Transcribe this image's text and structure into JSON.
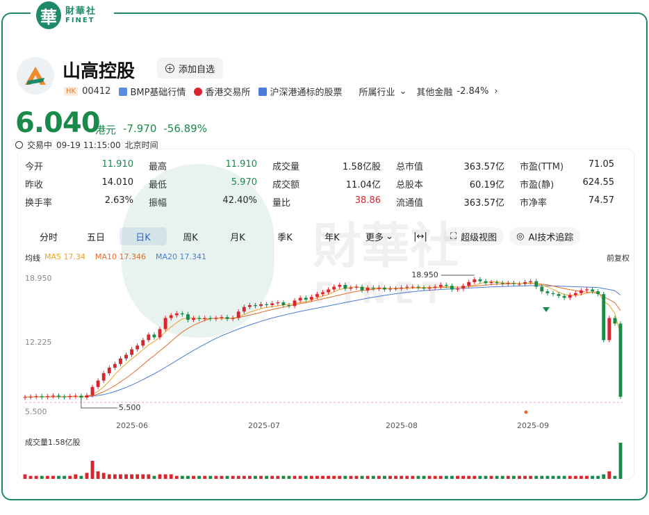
{
  "brand": {
    "mark": "華",
    "name_cn": "財華社",
    "name_en": "FINET"
  },
  "stock": {
    "name": "山高控股",
    "market_tag": "HK",
    "code": "00412",
    "watch_label": "添加自选",
    "links": [
      "BMP基础行情",
      "香港交易所",
      "沪深港通标的股票"
    ],
    "industry_label": "所属行业",
    "industry_name": "其他金融",
    "industry_change": "-2.84%"
  },
  "quote": {
    "price": "6.040",
    "currency": "港元",
    "change": "-7.970",
    "change_pct": "-56.89%",
    "status": "交易中",
    "time": "09-19 11:15:00",
    "tz": "北京时间"
  },
  "stats": [
    [
      {
        "label": "今开",
        "value": "11.910",
        "color": "#1a8a4a"
      },
      {
        "label": "最高",
        "value": "11.910",
        "color": "#1a8a4a"
      },
      {
        "label": "成交量",
        "value": "1.58亿股",
        "color": "#222"
      },
      {
        "label": "总市值",
        "value": "363.57亿",
        "color": "#222"
      },
      {
        "label": "市盈(TTM)",
        "value": "71.05",
        "color": "#222"
      }
    ],
    [
      {
        "label": "昨收",
        "value": "14.010",
        "color": "#222"
      },
      {
        "label": "最低",
        "value": "5.970",
        "color": "#1a8a4a"
      },
      {
        "label": "成交额",
        "value": "11.04亿",
        "color": "#222"
      },
      {
        "label": "总股本",
        "value": "60.19亿",
        "color": "#222"
      },
      {
        "label": "市盈(静)",
        "value": "624.55",
        "color": "#222"
      }
    ],
    [
      {
        "label": "换手率",
        "value": "2.63%",
        "color": "#222"
      },
      {
        "label": "振幅",
        "value": "42.40%",
        "color": "#222"
      },
      {
        "label": "量比",
        "value": "38.86",
        "color": "#d9262e"
      },
      {
        "label": "流通值",
        "value": "363.57亿",
        "color": "#222"
      },
      {
        "label": "市净率",
        "value": "74.57",
        "color": "#222"
      }
    ]
  ],
  "tabs": [
    "分时",
    "五日",
    "日K",
    "周K",
    "月K",
    "季K",
    "年K",
    "更多"
  ],
  "tools": {
    "fullscreen": "超级视图",
    "ai": "AI技术追踪"
  },
  "ma": {
    "label": "均线",
    "ma5": "MA5 17.34",
    "ma10": "MA10 17.346",
    "ma20": "MA20 17.341",
    "adjust": "前复权"
  },
  "colors": {
    "up": "#d9262e",
    "down": "#1a8a4a",
    "ma5": "#f0a020",
    "ma10": "#e86b2a",
    "ma20": "#4a7bd8",
    "accent": "#1f8a6a"
  },
  "chart_data": {
    "type": "candlestick",
    "y_ticks": [
      "18.950",
      "12.225",
      "5.500"
    ],
    "ylim": [
      5.5,
      18.95
    ],
    "x_ticks": [
      "2025-06",
      "2025-07",
      "2025-08",
      "2025-09"
    ],
    "max_label": "18.950",
    "min_label": "5.500",
    "volume_label": "成交量1.58亿股",
    "close": [
      6.0,
      6.05,
      6.1,
      6.0,
      6.1,
      6.15,
      6.05,
      6.0,
      6.1,
      6.15,
      5.95,
      6.2,
      7.1,
      7.8,
      8.6,
      9.2,
      9.6,
      10.2,
      10.6,
      11.2,
      11.6,
      12.2,
      12.8,
      12.5,
      13.4,
      14.6,
      14.9,
      15.1,
      15.0,
      14.4,
      14.6,
      14.5,
      14.6,
      14.5,
      14.6,
      14.7,
      14.5,
      14.6,
      15.3,
      15.8,
      16.0,
      15.9,
      16.1,
      16.0,
      16.2,
      16.3,
      16.0,
      15.9,
      16.5,
      16.8,
      16.6,
      16.9,
      17.2,
      17.4,
      17.7,
      18.0,
      18.2,
      17.8,
      17.9,
      18.0,
      17.6,
      17.9,
      17.8,
      17.9,
      17.7,
      17.8,
      17.8,
      17.9,
      18.0,
      18.0,
      17.9,
      17.8,
      17.9,
      18.0,
      18.2,
      18.1,
      17.7,
      17.8,
      18.1,
      18.5,
      18.8,
      18.6,
      18.4,
      18.5,
      18.4,
      18.3,
      18.4,
      18.3,
      18.3,
      18.5,
      18.6,
      18.0,
      17.5,
      17.3,
      17.2,
      17.0,
      16.8,
      17.1,
      17.3,
      17.6,
      17.7,
      17.5,
      17.2,
      12.2,
      14.6,
      14.0,
      6.04
    ],
    "ma5": [
      6.0,
      6.03,
      6.05,
      6.04,
      6.05,
      6.08,
      6.08,
      6.07,
      6.08,
      6.09,
      6.05,
      6.09,
      6.3,
      6.64,
      7.12,
      7.74,
      8.46,
      9.08,
      9.64,
      10.16,
      10.64,
      11.16,
      11.68,
      12.06,
      12.5,
      13.1,
      13.64,
      14.1,
      14.5,
      14.6,
      14.6,
      14.52,
      14.52,
      14.52,
      14.56,
      14.58,
      14.58,
      14.58,
      14.74,
      14.98,
      15.24,
      15.42,
      15.62,
      15.76,
      15.84,
      15.92,
      16.02,
      16.08,
      16.18,
      16.3,
      16.36,
      16.54,
      16.8,
      16.98,
      17.16,
      17.44,
      17.7,
      17.82,
      17.92,
      17.98,
      17.9,
      17.84,
      17.84,
      17.84,
      17.78,
      17.82,
      17.8,
      17.82,
      17.84,
      17.88,
      17.92,
      17.92,
      17.92,
      17.92,
      17.96,
      18.0,
      17.98,
      17.96,
      17.98,
      18.04,
      18.18,
      18.36,
      18.48,
      18.56,
      18.54,
      18.44,
      18.4,
      18.38,
      18.34,
      18.36,
      18.42,
      18.34,
      18.18,
      17.98,
      17.72,
      17.4,
      17.16,
      17.08,
      17.08,
      17.16,
      17.3,
      17.44,
      17.46,
      16.44,
      15.98,
      15.1,
      12.8
    ],
    "ma10": [
      6.0,
      6.02,
      6.03,
      6.03,
      6.04,
      6.05,
      6.05,
      6.05,
      6.06,
      6.07,
      6.06,
      6.08,
      6.16,
      6.34,
      6.58,
      6.9,
      7.26,
      7.66,
      8.08,
      8.52,
      9.0,
      9.52,
      10.06,
      10.52,
      11.02,
      11.52,
      12.04,
      12.58,
      13.08,
      13.48,
      13.82,
      14.08,
      14.34,
      14.52,
      14.58,
      14.6,
      14.56,
      14.56,
      14.66,
      14.78,
      14.92,
      15.06,
      15.22,
      15.38,
      15.52,
      15.66,
      15.78,
      15.9,
      16.04,
      16.16,
      16.26,
      16.4,
      16.54,
      16.68,
      16.82,
      16.96,
      17.1,
      17.24,
      17.38,
      17.5,
      17.6,
      17.66,
      17.72,
      17.78,
      17.8,
      17.82,
      17.83,
      17.84,
      17.85,
      17.86,
      17.87,
      17.88,
      17.89,
      17.9,
      17.92,
      17.94,
      17.95,
      17.96,
      17.98,
      18.02,
      18.06,
      18.12,
      18.18,
      18.24,
      18.28,
      18.3,
      18.32,
      18.34,
      18.35,
      18.36,
      18.37,
      18.34,
      18.28,
      18.2,
      18.08,
      17.94,
      17.8,
      17.68,
      17.58,
      17.5,
      17.42,
      17.36,
      17.3,
      16.92,
      16.6,
      16.26,
      15.4
    ],
    "ma20": [
      6.0,
      6.01,
      6.02,
      6.02,
      6.03,
      6.03,
      6.04,
      6.04,
      6.05,
      6.05,
      6.05,
      6.06,
      6.1,
      6.18,
      6.28,
      6.42,
      6.6,
      6.82,
      7.06,
      7.32,
      7.6,
      7.9,
      8.22,
      8.54,
      8.88,
      9.24,
      9.6,
      9.98,
      10.36,
      10.72,
      11.08,
      11.42,
      11.76,
      12.08,
      12.38,
      12.66,
      12.92,
      13.16,
      13.4,
      13.62,
      13.84,
      14.04,
      14.24,
      14.42,
      14.6,
      14.76,
      14.9,
      15.04,
      15.18,
      15.32,
      15.44,
      15.56,
      15.68,
      15.8,
      15.92,
      16.04,
      16.16,
      16.28,
      16.4,
      16.52,
      16.64,
      16.76,
      16.86,
      16.96,
      17.06,
      17.16,
      17.24,
      17.32,
      17.4,
      17.46,
      17.52,
      17.58,
      17.62,
      17.66,
      17.7,
      17.74,
      17.77,
      17.8,
      17.83,
      17.86,
      17.89,
      17.92,
      17.95,
      17.98,
      18.0,
      18.02,
      18.04,
      18.06,
      18.08,
      18.1,
      18.12,
      18.12,
      18.11,
      18.1,
      18.08,
      18.06,
      18.04,
      18.02,
      18.0,
      17.98,
      17.96,
      17.94,
      17.92,
      17.8,
      17.7,
      17.56,
      17.1
    ],
    "volume": [
      0.03,
      0.02,
      0.02,
      0.02,
      0.02,
      0.02,
      0.02,
      0.02,
      0.02,
      0.03,
      0.02,
      0.04,
      0.12,
      0.05,
      0.04,
      0.03,
      0.03,
      0.03,
      0.03,
      0.03,
      0.03,
      0.03,
      0.03,
      0.02,
      0.03,
      0.03,
      0.03,
      0.02,
      0.02,
      0.02,
      0.02,
      0.02,
      0.02,
      0.02,
      0.02,
      0.02,
      0.02,
      0.02,
      0.02,
      0.02,
      0.02,
      0.02,
      0.02,
      0.02,
      0.02,
      0.02,
      0.02,
      0.02,
      0.02,
      0.02,
      0.02,
      0.02,
      0.02,
      0.02,
      0.02,
      0.02,
      0.02,
      0.02,
      0.02,
      0.02,
      0.02,
      0.02,
      0.02,
      0.02,
      0.02,
      0.02,
      0.02,
      0.02,
      0.02,
      0.02,
      0.02,
      0.02,
      0.02,
      0.02,
      0.02,
      0.02,
      0.02,
      0.02,
      0.02,
      0.02,
      0.02,
      0.02,
      0.02,
      0.02,
      0.02,
      0.02,
      0.02,
      0.02,
      0.02,
      0.02,
      0.02,
      0.02,
      0.02,
      0.02,
      0.02,
      0.02,
      0.02,
      0.02,
      0.02,
      0.02,
      0.02,
      0.02,
      0.02,
      0.03,
      0.05,
      0.02,
      0.24
    ],
    "volume_unit": "亿股"
  }
}
